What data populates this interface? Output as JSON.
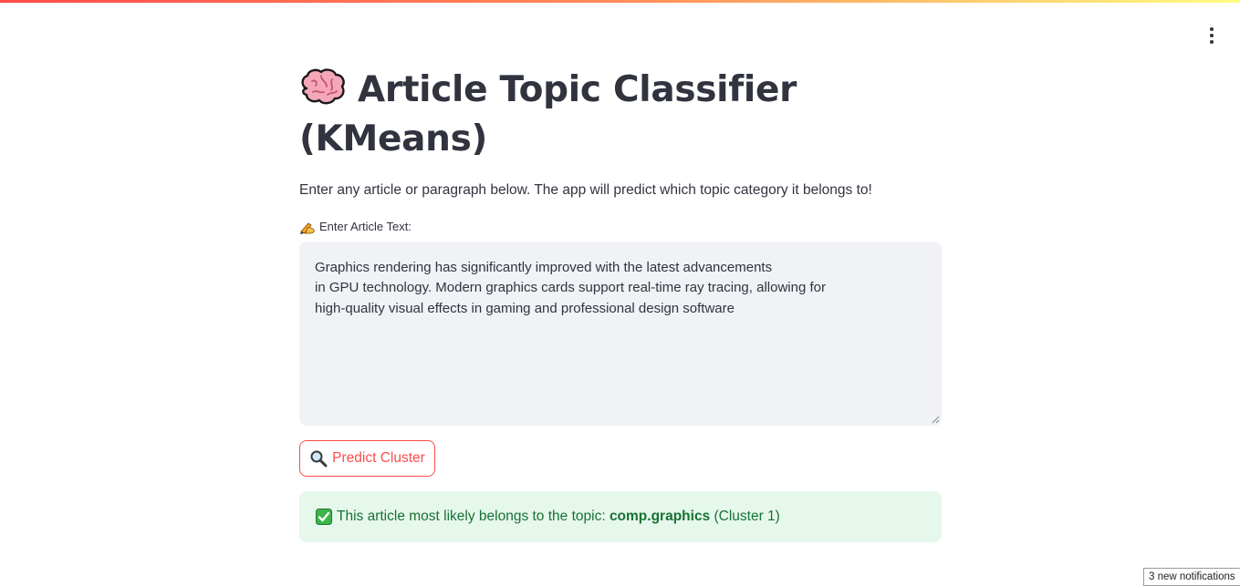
{
  "header": {
    "menu_icon": "kebab-menu-icon"
  },
  "main": {
    "title_icon": "brain-icon",
    "title": "Article Topic Classifier (KMeans)",
    "description": "Enter any article or paragraph below. The app will predict which topic category it belongs to!",
    "input": {
      "label_icon": "writing-hand-icon",
      "label": "Enter Article Text:",
      "value": "Graphics rendering has significantly improved with the latest advancements\nin GPU technology. Modern graphics cards support real-time ray tracing, allowing for\nhigh-quality visual effects in gaming and professional design software"
    },
    "predict_button": {
      "icon": "magnifier-icon",
      "label": "Predict Cluster"
    },
    "result": {
      "icon": "check-mark-icon",
      "prefix": "This article most likely belongs to the topic: ",
      "topic": "comp.graphics",
      "suffix": " (Cluster 1)"
    }
  },
  "notifications": {
    "label": "3 new notifications"
  },
  "colors": {
    "accent": "#ff4b4b",
    "text": "#31333f",
    "input_bg": "#f0f2f6",
    "success_bg": "#e6f7ec",
    "success_text": "#177233"
  }
}
